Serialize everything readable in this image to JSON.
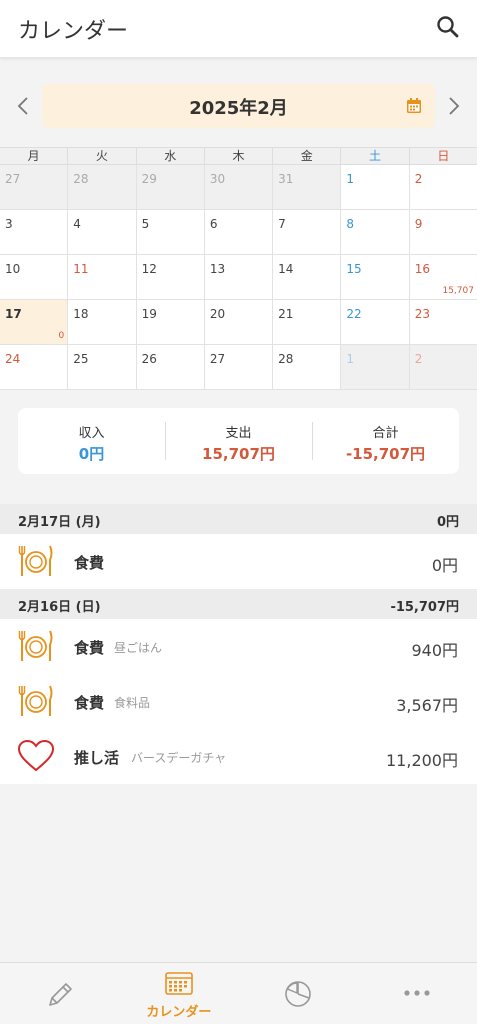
{
  "header": {
    "title": "カレンダー",
    "search_icon": "search-icon"
  },
  "month_nav": {
    "label": "2025年2月",
    "prev_icon": "chevron-left-icon",
    "next_icon": "chevron-right-icon",
    "calendar_icon": "calendar-icon"
  },
  "weekdays": [
    "月",
    "火",
    "水",
    "木",
    "金",
    "土",
    "日"
  ],
  "calendar": {
    "rows": [
      [
        {
          "d": "27",
          "other": true
        },
        {
          "d": "28",
          "other": true
        },
        {
          "d": "29",
          "other": true
        },
        {
          "d": "30",
          "other": true
        },
        {
          "d": "31",
          "other": true
        },
        {
          "d": "1"
        },
        {
          "d": "2"
        }
      ],
      [
        {
          "d": "3"
        },
        {
          "d": "4"
        },
        {
          "d": "5"
        },
        {
          "d": "6"
        },
        {
          "d": "7"
        },
        {
          "d": "8"
        },
        {
          "d": "9"
        }
      ],
      [
        {
          "d": "10"
        },
        {
          "d": "11",
          "holiday": true
        },
        {
          "d": "12"
        },
        {
          "d": "13"
        },
        {
          "d": "14"
        },
        {
          "d": "15"
        },
        {
          "d": "16",
          "amount": "15,707"
        }
      ],
      [
        {
          "d": "17",
          "today": true,
          "amount": "0"
        },
        {
          "d": "18"
        },
        {
          "d": "19"
        },
        {
          "d": "20"
        },
        {
          "d": "21"
        },
        {
          "d": "22"
        },
        {
          "d": "23"
        }
      ],
      [
        {
          "d": "24",
          "holiday": true
        },
        {
          "d": "25"
        },
        {
          "d": "26"
        },
        {
          "d": "27"
        },
        {
          "d": "28"
        },
        {
          "d": "1",
          "other": true
        },
        {
          "d": "2",
          "other": true
        }
      ]
    ]
  },
  "summary": {
    "income_label": "収入",
    "income_value": "0円",
    "expense_label": "支出",
    "expense_value": "15,707円",
    "total_label": "合計",
    "total_value": "-15,707円"
  },
  "groups": [
    {
      "date": "2月17日 (月)",
      "total": "0円",
      "items": [
        {
          "icon": "dining-icon",
          "category": "食費",
          "memo": "",
          "amount": "0円"
        }
      ]
    },
    {
      "date": "2月16日 (日)",
      "total": "-15,707円",
      "items": [
        {
          "icon": "dining-icon",
          "category": "食費",
          "memo": "昼ごはん",
          "amount": "940円"
        },
        {
          "icon": "dining-icon",
          "category": "食費",
          "memo": "食料品",
          "amount": "3,567円"
        },
        {
          "icon": "heart-icon",
          "category": "推し活",
          "memo": "バースデーガチャ",
          "amount": "11,200円"
        }
      ]
    }
  ],
  "bottom_nav": {
    "items": [
      {
        "icon": "pencil-icon",
        "label": ""
      },
      {
        "icon": "calendar-icon",
        "label": "カレンダー",
        "active": true
      },
      {
        "icon": "pie-chart-icon",
        "label": ""
      },
      {
        "icon": "more-icon",
        "label": ""
      }
    ]
  },
  "colors": {
    "accent": "#e8921e",
    "income": "#3a96d6",
    "expense": "#d4583a",
    "month_bg": "#fdf1de"
  }
}
